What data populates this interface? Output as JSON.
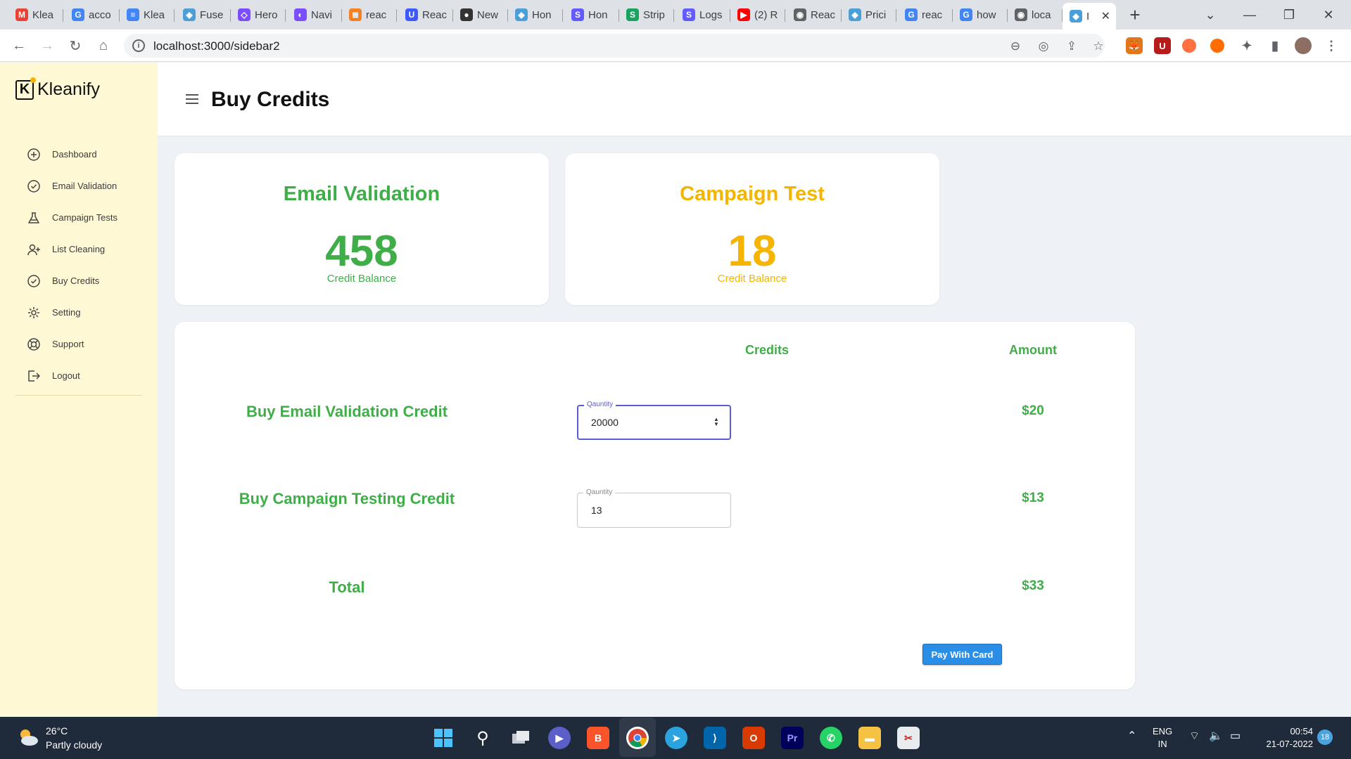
{
  "browser": {
    "tabs": [
      {
        "title": "Klea",
        "icon": "gmail-icon",
        "color": "#ea4335",
        "glyph": "M"
      },
      {
        "title": "acco",
        "icon": "google-icon",
        "color": "#4285f4",
        "glyph": "G"
      },
      {
        "title": "Klea",
        "icon": "docs-icon",
        "color": "#4285f4",
        "glyph": "≡"
      },
      {
        "title": "Fuse",
        "icon": "fuse-icon",
        "color": "#4a9fd8",
        "glyph": "◆"
      },
      {
        "title": "Hero",
        "icon": "hero-icon",
        "color": "#7c4dff",
        "glyph": "◇"
      },
      {
        "title": "Navi",
        "icon": "navi-icon",
        "color": "#7c4dff",
        "glyph": "◐"
      },
      {
        "title": "reac",
        "icon": "stackoverflow-icon",
        "color": "#f48024",
        "glyph": "≣"
      },
      {
        "title": "Reac",
        "icon": "u-icon",
        "color": "#3d5afe",
        "glyph": "U"
      },
      {
        "title": "New",
        "icon": "github-icon",
        "color": "#333333",
        "glyph": "●"
      },
      {
        "title": "Hon",
        "icon": "fuse-icon",
        "color": "#4a9fd8",
        "glyph": "◆"
      },
      {
        "title": "Hon",
        "icon": "s-icon",
        "color": "#635bff",
        "glyph": "S"
      },
      {
        "title": "Strip",
        "icon": "s-icon",
        "color": "#1aa260",
        "glyph": "S"
      },
      {
        "title": "Logs",
        "icon": "s-icon",
        "color": "#635bff",
        "glyph": "S"
      },
      {
        "title": "(2) R",
        "icon": "youtube-icon",
        "color": "#ff0000",
        "glyph": "▶"
      },
      {
        "title": "Reac",
        "icon": "globe-icon",
        "color": "#5f6368",
        "glyph": "◉"
      },
      {
        "title": "Prici",
        "icon": "fuse-icon",
        "color": "#4a9fd8",
        "glyph": "◆"
      },
      {
        "title": "reac",
        "icon": "google-icon",
        "color": "#4285f4",
        "glyph": "G"
      },
      {
        "title": "how",
        "icon": "google-icon",
        "color": "#4285f4",
        "glyph": "G"
      },
      {
        "title": "loca",
        "icon": "globe-icon",
        "color": "#5f6368",
        "glyph": "◉"
      },
      {
        "title": "I",
        "icon": "fuse-icon",
        "color": "#4a9fd8",
        "glyph": "◆"
      }
    ],
    "url": "localhost:3000/sidebar2"
  },
  "app": {
    "brand": "Kleanify",
    "brand_mark": "K",
    "page_title": "Buy Credits",
    "sidebar": {
      "items": [
        {
          "label": "Dashboard",
          "icon": "plus-circle-icon"
        },
        {
          "label": "Email Validation",
          "icon": "check-circle-icon"
        },
        {
          "label": "Campaign Tests",
          "icon": "flask-icon"
        },
        {
          "label": "List Cleaning",
          "icon": "user-plus-icon"
        },
        {
          "label": "Buy Credits",
          "icon": "check-circle-icon"
        },
        {
          "label": "Setting",
          "icon": "gear-icon"
        },
        {
          "label": "Support",
          "icon": "lifebuoy-icon"
        },
        {
          "label": "Logout",
          "icon": "logout-icon"
        }
      ]
    },
    "cards": [
      {
        "title": "Email Validation",
        "value": "458",
        "caption": "Credit Balance",
        "color": "#3fae48"
      },
      {
        "title": "Campaign Test",
        "value": "18",
        "caption": "Credit Balance",
        "color": "#f4b400"
      }
    ],
    "purchase": {
      "col_credits": "Credits",
      "col_amount": "Amount",
      "rows": [
        {
          "label": "Buy Email Validation Credit",
          "field_label": "Qauntity",
          "quantity": "20000",
          "amount": "$20"
        },
        {
          "label": "Buy Campaign Testing Credit",
          "field_label": "Qauntity",
          "quantity": "13",
          "amount": "$13"
        }
      ],
      "total_label": "Total",
      "total_amount": "$33",
      "pay_button": "Pay With Card"
    }
  },
  "taskbar": {
    "weather_temp": "26°C",
    "weather_desc": "Partly cloudy",
    "lang_top": "ENG",
    "lang_bottom": "IN",
    "time": "00:54",
    "date": "21-07-2022",
    "notifications": "18"
  }
}
